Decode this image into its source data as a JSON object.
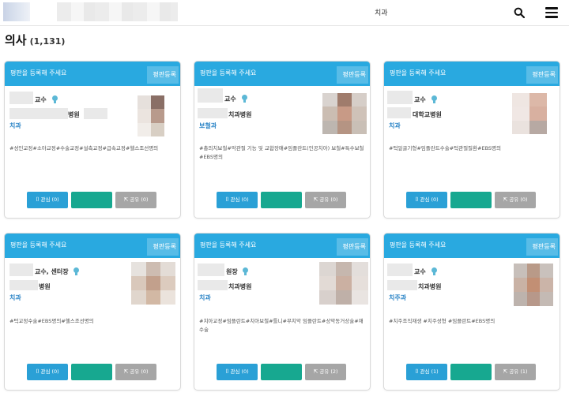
{
  "header": {
    "title": "치과",
    "search_icon": "search-icon",
    "menu_icon": "hamburger-menu-icon"
  },
  "page": {
    "heading": "의사",
    "count": "(1,131)"
  },
  "cards": [
    {
      "head_text": "평판을 등록해 주세요",
      "head_button": "평판등록",
      "role": "교수",
      "hospital": "병원",
      "specialty": "치과",
      "tags": "#성인교정#소아교정#수술교정#설측교정#급속교정#헬스조선명의",
      "like_label": "관심 (0)",
      "share_label": "공유 (0)"
    },
    {
      "head_text": "평판을 등록해 주세요",
      "head_button": "평판등록",
      "role": "교수",
      "hospital": "치과병원",
      "specialty": "보철과",
      "tags": "#총의치보철#악관절 기능 및 교합장애#임플란트(인공치아) 보철#특수보철#EBS명의",
      "like_label": "관심 (0)",
      "share_label": "공유 (0)"
    },
    {
      "head_text": "평판을 등록해 주세요",
      "head_button": "평판등록",
      "role": "교수",
      "hospital": "대학교병원",
      "specialty": "치과",
      "tags": "#턱얼굴기형#임플란트수술#턱관절질환#EBS명의",
      "like_label": "관심 (0)",
      "share_label": "공유 (0)"
    },
    {
      "head_text": "평판을 등록해 주세요",
      "head_button": "평판등록",
      "role": "교수, 센터장",
      "hospital": "병원",
      "specialty": "치과",
      "tags": "#턱교정수술#EBS명의#헬스조선명의",
      "like_label": "관심 (0)",
      "share_label": "공유 (0)"
    },
    {
      "head_text": "평판을 등록해 주세요",
      "head_button": "평판등록",
      "role": "원장",
      "hospital": "치과병원",
      "specialty": "치과",
      "tags": "#치아교정#임플란트#치아보철#틀니#무치악 임플란트#상악동거상술#재수술",
      "like_label": "관심 (0)",
      "share_label": "공유 (2)"
    },
    {
      "head_text": "평판을 등록해 주세요",
      "head_button": "평판등록",
      "role": "교수",
      "hospital": "치과병원",
      "specialty": "치주과",
      "tags": "#치주조직재생 #치주성형 #임플란트#EBS명의",
      "like_label": "관심 (1)",
      "share_label": "공유 (1)"
    }
  ],
  "colors": {
    "card_header": "#29a9e0",
    "like_button": "#2aa0d6",
    "blurred_button": "#17a890",
    "share_button": "#a6a6a6",
    "specialty_text": "#2a84c6"
  },
  "icons": {
    "badge": "verified-badge-icon",
    "like": "bookmark-icon",
    "share": "share-icon"
  }
}
